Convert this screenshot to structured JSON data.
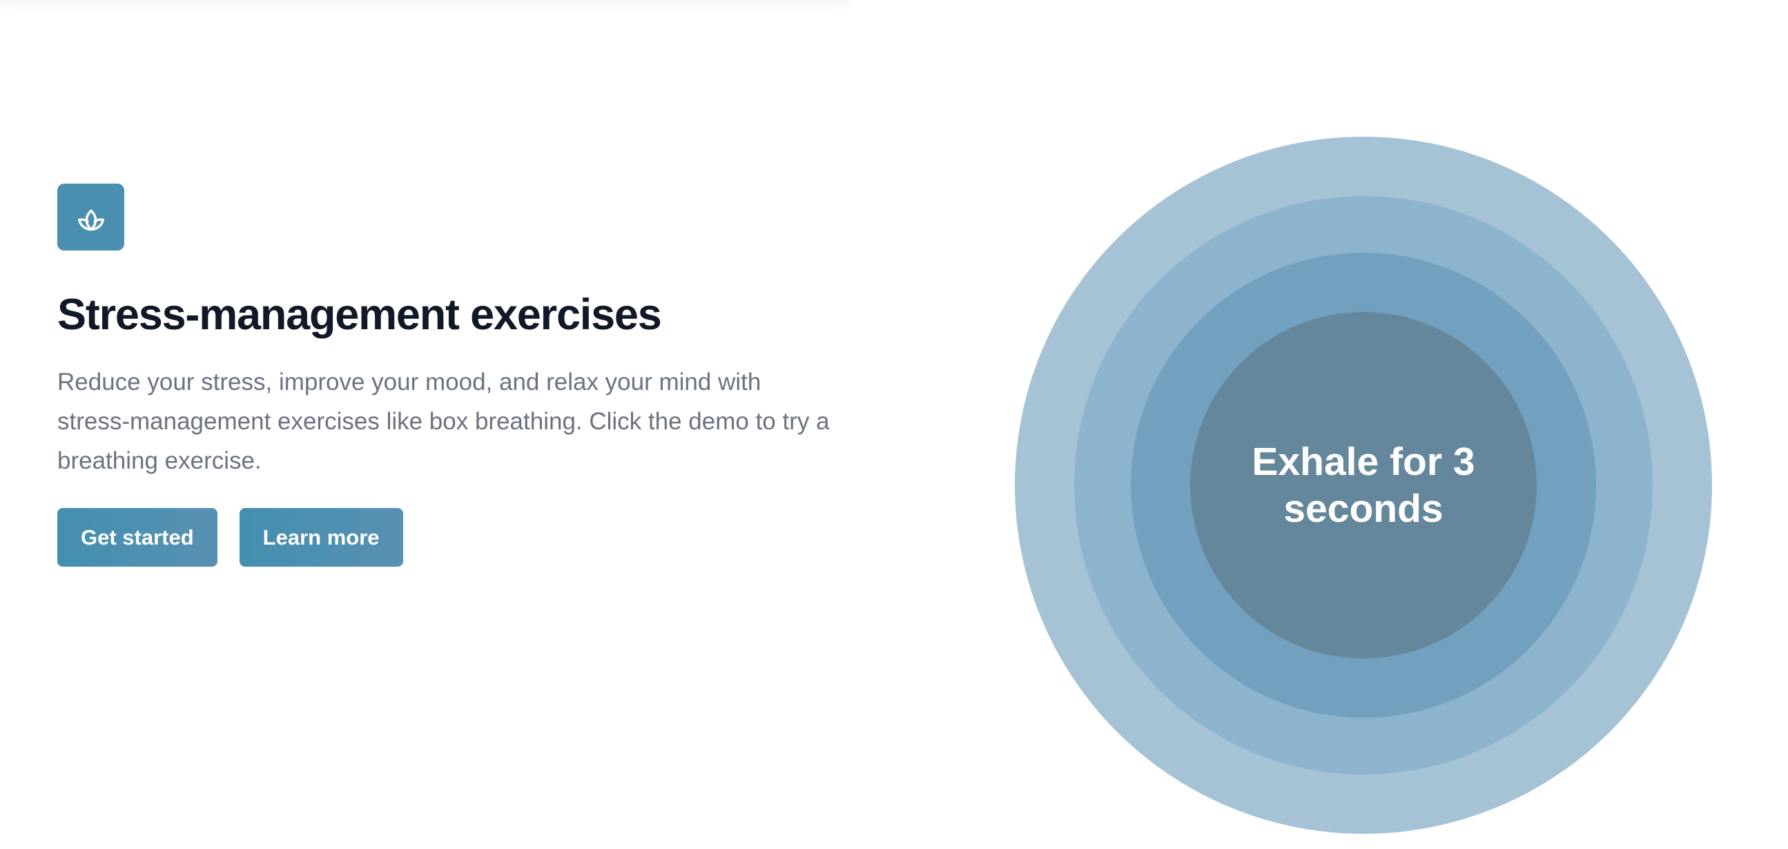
{
  "feature": {
    "icon": "lotus-icon",
    "title": "Stress-management exercises",
    "description": "Reduce your stress, improve your mood, and relax your mind with stress-management exercises like box breathing. Click the demo to try a breathing exercise.",
    "primary_button": "Get started",
    "secondary_button": "Learn more"
  },
  "demo": {
    "instruction": "Exhale for 3 seconds"
  },
  "colors": {
    "accent": "#4a8fb0",
    "ring_outer": "#a6c3d6",
    "ring_2": "#8cb4cd",
    "ring_3": "#72a1bf",
    "ring_inner": "#64879c",
    "title": "#111827",
    "body_text": "#6b7280"
  }
}
